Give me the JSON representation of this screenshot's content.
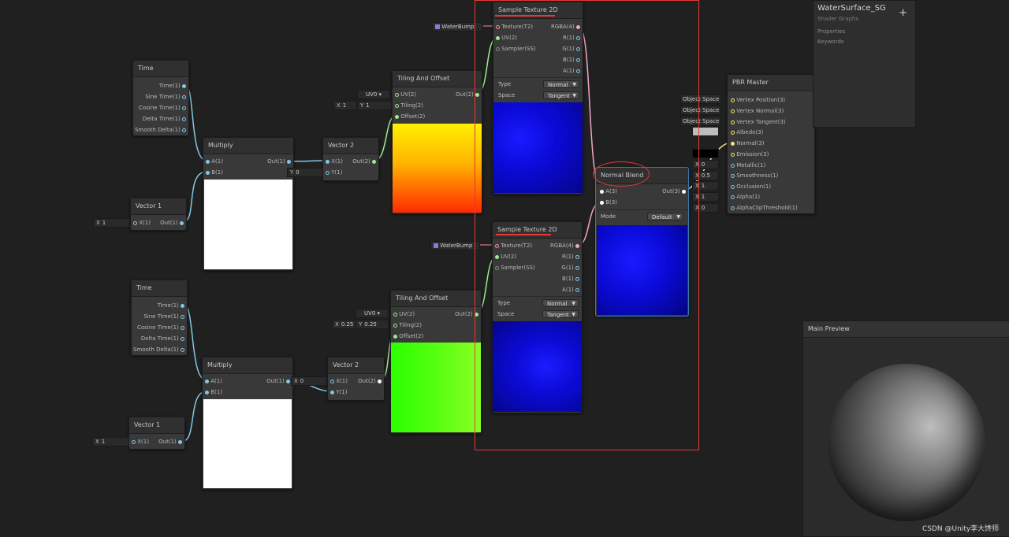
{
  "nodes": {
    "time1": {
      "title": "Time",
      "outputs": [
        "Time(1)",
        "Sine Time(1)",
        "Cosine Time(1)",
        "Delta Time(1)",
        "Smooth Delta(1)"
      ]
    },
    "time2": {
      "title": "Time",
      "outputs": [
        "Time(1)",
        "Sine Time(1)",
        "Cosine Time(1)",
        "Delta Time(1)",
        "Smooth Delta(1)"
      ]
    },
    "multiply1": {
      "title": "Multiply",
      "in_a": "A(1)",
      "in_b": "B(1)",
      "out": "Out(1)"
    },
    "multiply2": {
      "title": "Multiply",
      "in_a": "A(1)",
      "in_b": "B(1)",
      "out": "Out(1)"
    },
    "vector1_a": {
      "title": "Vector 1",
      "in_x": "X(1)",
      "out": "Out(1)",
      "x_label": "X",
      "x_value": "1"
    },
    "vector1_b": {
      "title": "Vector 1",
      "in_x": "X(1)",
      "out": "Out(1)",
      "x_label": "X",
      "x_value": "1"
    },
    "vector2_a": {
      "title": "Vector 2",
      "in_x": "X(1)",
      "in_y": "Y(1)",
      "out": "Out(2)",
      "y_label": "Y",
      "y_value": "0"
    },
    "vector2_b": {
      "title": "Vector 2",
      "in_x": "X(1)",
      "in_y": "Y(1)",
      "out": "Out(2)",
      "x_label": "X",
      "x_value": "0"
    },
    "tiling1": {
      "title": "Tiling And Offset",
      "in_uv": "UV(2)",
      "in_tiling": "Tiling(2)",
      "in_offset": "Offset(2)",
      "out": "Out(2)",
      "uv_channel": "UV0",
      "tile_x_label": "X",
      "tile_x": "1",
      "tile_y_label": "Y",
      "tile_y": "1"
    },
    "tiling2": {
      "title": "Tiling And Offset",
      "in_uv": "UV(2)",
      "in_tiling": "Tiling(2)",
      "in_offset": "Offset(2)",
      "out": "Out(2)",
      "uv_channel": "UV0",
      "tile_x_label": "X",
      "tile_x": "0.25",
      "tile_y_label": "Y",
      "tile_y": "0.25"
    },
    "sample1": {
      "title": "Sample Texture 2D",
      "in_texture": "Texture(T2)",
      "in_uv": "UV(2)",
      "in_sampler": "Sampler(SS)",
      "outputs": [
        "RGBA(4)",
        "R(1)",
        "G(1)",
        "B(1)",
        "A(1)"
      ],
      "type_label": "Type",
      "type_value": "Normal",
      "space_label": "Space",
      "space_value": "Tangent",
      "texture_field": "WaterBump"
    },
    "sample2": {
      "title": "Sample Texture 2D",
      "in_texture": "Texture(T2)",
      "in_uv": "UV(2)",
      "in_sampler": "Sampler(SS)",
      "outputs": [
        "RGBA(4)",
        "R(1)",
        "G(1)",
        "B(1)",
        "A(1)"
      ],
      "type_label": "Type",
      "type_value": "Normal",
      "space_label": "Space",
      "space_value": "Tangent",
      "texture_field": "WaterBump"
    },
    "normal_blend": {
      "title": "Normal Blend",
      "in_a": "A(3)",
      "in_b": "B(3)",
      "out": "Out(3)",
      "mode_label": "Mode",
      "mode_value": "Default"
    },
    "pbr": {
      "title": "PBR Master",
      "inputs": [
        "Vertex Position(3)",
        "Vertex Normal(3)",
        "Vertex Tangent(3)",
        "Albedo(3)",
        "Normal(3)",
        "Emission(3)",
        "Metallic(1)",
        "Smoothness(1)",
        "Occlusion(1)",
        "Alpha(1)",
        "AlphaClipThreshold(1)"
      ],
      "space_fields": [
        "Object Space",
        "Object Space",
        "Object Space"
      ],
      "metallic_label": "X",
      "metallic_value": "0",
      "smoothness_label": "X",
      "smoothness_value": "0.5",
      "occlusion_label": "X",
      "occlusion_value": "1",
      "alpha_label": "X",
      "alpha_value": "1",
      "clip_label": "X",
      "clip_value": "0"
    }
  },
  "blackboard": {
    "title": "WaterSurface_SG",
    "subtitle": "Shader Graphs",
    "properties": "Properties",
    "keywords": "Keywords",
    "add": "+"
  },
  "main_preview": {
    "title": "Main Preview"
  },
  "watermark": "CSDN @Unity李大馋师",
  "colors": {
    "highlight": "#e53935",
    "background": "#202020",
    "node": "#393939"
  }
}
